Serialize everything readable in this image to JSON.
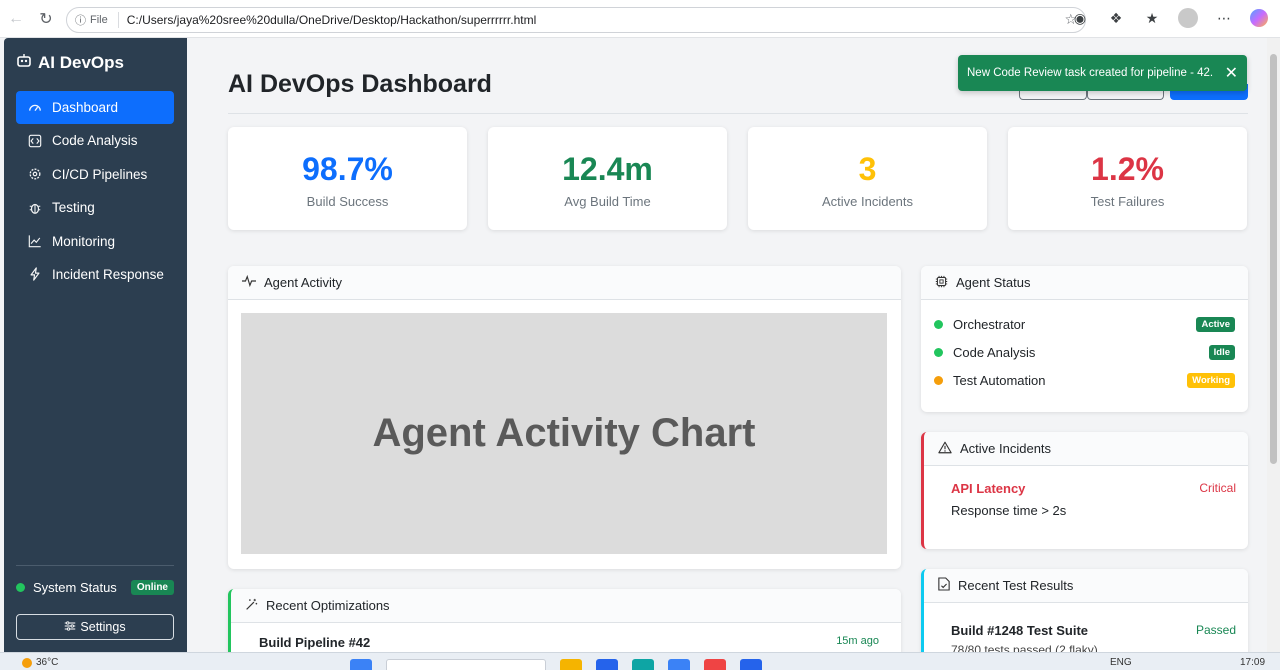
{
  "browser": {
    "file_label": "File",
    "url": "C:/Users/jaya%20sree%20dulla/OneDrive/Desktop/Hackathon/superrrrrr.html"
  },
  "sidebar": {
    "brand": "AI DevOps",
    "items": [
      {
        "label": "Dashboard",
        "icon": "speedometer-icon",
        "active": true
      },
      {
        "label": "Code Analysis",
        "icon": "code-square-icon",
        "active": false
      },
      {
        "label": "CI/CD Pipelines",
        "icon": "gear-icon",
        "active": false
      },
      {
        "label": "Testing",
        "icon": "bug-icon",
        "active": false
      },
      {
        "label": "Monitoring",
        "icon": "graph-up-icon",
        "active": false
      },
      {
        "label": "Incident Response",
        "icon": "lightning-icon",
        "active": false
      }
    ],
    "system_status_label": "System Status",
    "system_status_badge": "Online",
    "settings_label": "Settings"
  },
  "main": {
    "title": "AI DevOps Dashboard",
    "stats": [
      {
        "value": "98.7%",
        "label": "Build Success",
        "color": "#0d6efd"
      },
      {
        "value": "12.4m",
        "label": "Avg Build Time",
        "color": "#198754"
      },
      {
        "value": "3",
        "label": "Active Incidents",
        "color": "#ffc107"
      },
      {
        "value": "1.2%",
        "label": "Test Failures",
        "color": "#dc3545"
      }
    ],
    "agent_activity": {
      "title": "Agent Activity",
      "placeholder": "Agent Activity Chart"
    },
    "agent_status": {
      "title": "Agent Status",
      "agents": [
        {
          "name": "Orchestrator",
          "badge": "Active",
          "dot_color": "#22c55e",
          "badge_color": "#198754"
        },
        {
          "name": "Code Analysis",
          "badge": "Idle",
          "dot_color": "#22c55e",
          "badge_color": "#198754"
        },
        {
          "name": "Test Automation",
          "badge": "Working",
          "dot_color": "#f59e0b",
          "badge_color": "#ffc107"
        }
      ]
    },
    "active_incidents": {
      "title": "Active Incidents",
      "items": [
        {
          "name": "API Latency",
          "severity": "Critical",
          "detail": "Response time > 2s"
        }
      ]
    },
    "recent_optimizations": {
      "title": "Recent Optimizations",
      "items": [
        {
          "name": "Build Pipeline #42",
          "time": "15m ago"
        }
      ]
    },
    "recent_test_results": {
      "title": "Recent Test Results",
      "items": [
        {
          "name": "Build #1248 Test Suite",
          "status": "Passed",
          "detail": "78/80 tests passed (2 flaky)"
        }
      ]
    }
  },
  "toast": {
    "message": "New Code Review task created for pipeline - 42."
  },
  "taskbar": {
    "temperature": "36°C",
    "language": "ENG",
    "time": "17:09"
  }
}
